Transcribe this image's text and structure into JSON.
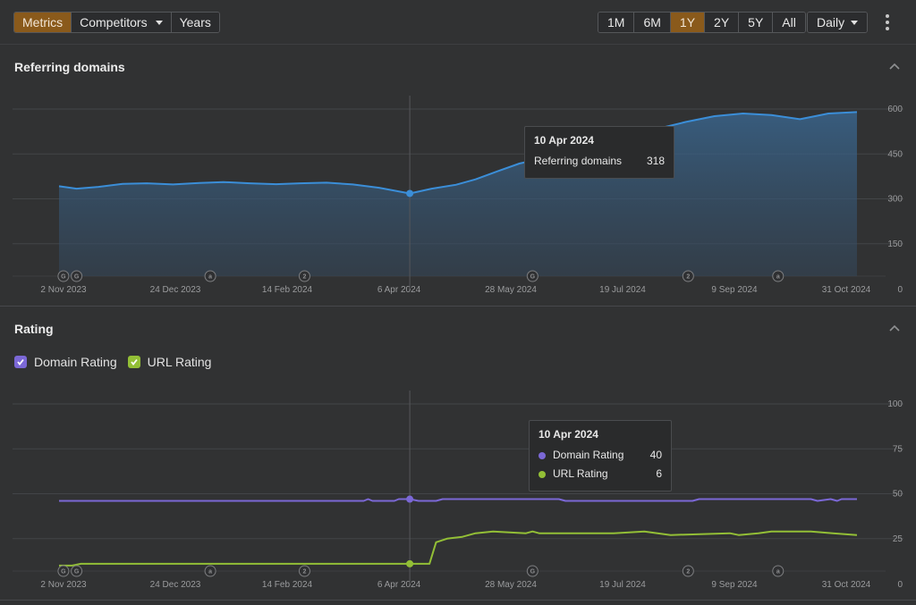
{
  "toolbar": {
    "view_tabs": [
      {
        "label": "Metrics",
        "active": true
      },
      {
        "label": "Competitors",
        "active": false,
        "dropdown": true
      },
      {
        "label": "Years",
        "active": false
      }
    ],
    "range_tabs": [
      {
        "label": "1M",
        "active": false
      },
      {
        "label": "6M",
        "active": false
      },
      {
        "label": "1Y",
        "active": true
      },
      {
        "label": "2Y",
        "active": false
      },
      {
        "label": "5Y",
        "active": false
      },
      {
        "label": "All",
        "active": false
      }
    ],
    "interval": {
      "label": "Daily",
      "icon": "chevron-down-icon"
    },
    "more_icon": "kebab-menu-icon",
    "accent_color": "#8a5a1b"
  },
  "sections": {
    "referring_domains": {
      "title": "Referring domains",
      "collapse_icon": "chevron-up-icon"
    },
    "rating": {
      "title": "Rating",
      "collapse_icon": "chevron-up-icon",
      "legend": [
        {
          "label": "Domain Rating",
          "checked": true,
          "color": "#7b68d6"
        },
        {
          "label": "URL Rating",
          "checked": true,
          "color": "#93bf36"
        }
      ]
    }
  },
  "tooltips": {
    "referring_domains": {
      "date": "10 Apr 2024",
      "rows": [
        {
          "label": "Referring domains",
          "value": "318"
        }
      ]
    },
    "rating": {
      "date": "10 Apr 2024",
      "rows": [
        {
          "label": "Domain Rating",
          "value": "40",
          "color": "#7b68d6"
        },
        {
          "label": "URL Rating",
          "value": "6",
          "color": "#93bf36"
        }
      ]
    }
  },
  "chart_data": [
    {
      "type": "area",
      "title": "Referring domains",
      "x_tick_labels": [
        "2 Nov 2023",
        "24 Dec 2023",
        "14 Feb 2024",
        "6 Apr 2024",
        "28 May 2024",
        "19 Jul 2024",
        "9 Sep 2024",
        "31 Oct 2024"
      ],
      "y_tick_labels": [
        "0",
        "150",
        "300",
        "450",
        "600"
      ],
      "ylim": [
        0,
        600
      ],
      "xrange": [
        "2023-11-02",
        "2024-10-31"
      ],
      "grid": true,
      "color": "#3b8ed8",
      "hover": {
        "date": "2024-04-10",
        "value": 318
      },
      "annotations": [
        {
          "date": "2023-11-04",
          "label": "G"
        },
        {
          "date": "2023-11-10",
          "label": "G"
        },
        {
          "date": "2024-01-10",
          "label": "a"
        },
        {
          "date": "2024-02-22",
          "label": "2"
        },
        {
          "date": "2024-06-05",
          "label": "G"
        },
        {
          "date": "2024-08-15",
          "label": "2"
        },
        {
          "date": "2024-09-25",
          "label": "a"
        }
      ],
      "series": [
        {
          "name": "Referring domains",
          "x": [
            "2023-11-02",
            "2023-11-10",
            "2023-11-20",
            "2023-12-01",
            "2023-12-12",
            "2023-12-24",
            "2024-01-05",
            "2024-01-16",
            "2024-01-28",
            "2024-02-09",
            "2024-02-20",
            "2024-03-03",
            "2024-03-15",
            "2024-03-27",
            "2024-04-10",
            "2024-04-20",
            "2024-05-01",
            "2024-05-10",
            "2024-05-20",
            "2024-05-30",
            "2024-06-10",
            "2024-06-22",
            "2024-07-05",
            "2024-07-19",
            "2024-08-01",
            "2024-08-14",
            "2024-08-27",
            "2024-09-09",
            "2024-09-22",
            "2024-10-05",
            "2024-10-18",
            "2024-10-31"
          ],
          "values": [
            342,
            334,
            340,
            350,
            352,
            348,
            353,
            356,
            352,
            349,
            352,
            354,
            348,
            337,
            318,
            334,
            347,
            365,
            392,
            418,
            436,
            450,
            478,
            508,
            534,
            557,
            576,
            585,
            580,
            566,
            585,
            590
          ]
        }
      ]
    },
    {
      "type": "line",
      "title": "Rating",
      "x_tick_labels": [
        "2 Nov 2023",
        "24 Dec 2023",
        "14 Feb 2024",
        "6 Apr 2024",
        "28 May 2024",
        "19 Jul 2024",
        "9 Sep 2024",
        "31 Oct 2024"
      ],
      "y_tick_labels": [
        "0",
        "25",
        "50",
        "75",
        "100"
      ],
      "ylim": [
        0,
        100
      ],
      "xrange": [
        "2023-11-02",
        "2024-10-31"
      ],
      "grid": true,
      "hover": {
        "date": "2024-04-10",
        "values": {
          "Domain Rating": 40,
          "URL Rating": 6
        }
      },
      "annotations": [
        {
          "date": "2023-11-04",
          "label": "G"
        },
        {
          "date": "2023-11-10",
          "label": "G"
        },
        {
          "date": "2024-01-10",
          "label": "a"
        },
        {
          "date": "2024-02-22",
          "label": "2"
        },
        {
          "date": "2024-06-05",
          "label": "G"
        },
        {
          "date": "2024-08-15",
          "label": "2"
        },
        {
          "date": "2024-09-25",
          "label": "a"
        }
      ],
      "series": [
        {
          "name": "Domain Rating",
          "color": "#7b68d6",
          "x": [
            "2023-11-02",
            "2024-03-20",
            "2024-03-22",
            "2024-03-24",
            "2024-04-03",
            "2024-04-05",
            "2024-04-10",
            "2024-04-14",
            "2024-04-22",
            "2024-04-25",
            "2024-06-17",
            "2024-06-20",
            "2024-08-17",
            "2024-08-20",
            "2024-10-10",
            "2024-10-13",
            "2024-10-19",
            "2024-10-22",
            "2024-10-24",
            "2024-10-31"
          ],
          "values": [
            46,
            46,
            47,
            46,
            46,
            47,
            47,
            46,
            46,
            47,
            47,
            46,
            46,
            47,
            47,
            46,
            47,
            46,
            47,
            47
          ]
        },
        {
          "name": "URL Rating",
          "color": "#93bf36",
          "x": [
            "2023-11-02",
            "2023-11-08",
            "2023-11-12",
            "2024-04-10",
            "2024-04-19",
            "2024-04-22",
            "2024-04-27",
            "2024-05-04",
            "2024-05-10",
            "2024-05-18",
            "2024-06-02",
            "2024-06-05",
            "2024-06-08",
            "2024-07-12",
            "2024-07-26",
            "2024-08-01",
            "2024-08-07",
            "2024-09-03",
            "2024-09-07",
            "2024-09-16",
            "2024-09-22",
            "2024-10-10",
            "2024-10-20",
            "2024-10-31"
          ],
          "values": [
            10,
            10,
            11,
            11,
            11,
            23,
            25,
            26,
            28,
            29,
            28,
            29,
            28,
            28,
            29,
            28,
            27,
            28,
            27,
            28,
            29,
            29,
            28,
            27
          ]
        }
      ]
    }
  ]
}
